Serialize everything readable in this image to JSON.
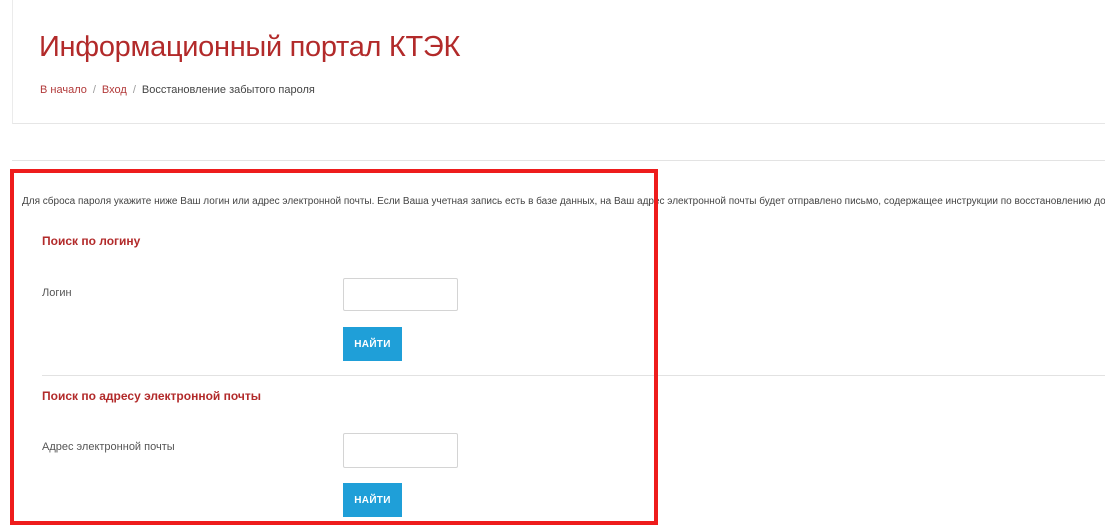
{
  "header": {
    "title": "Информационный портал КТЭК",
    "breadcrumb": {
      "home": "В начало",
      "separator": "/",
      "login": "Вход",
      "current": "Восстановление забытого пароля"
    }
  },
  "main": {
    "instructions": "Для сброса пароля укажите ниже Ваш логин или адрес электронной почты. Если Ваша учетная запись есть в базе данных, на Ваш адрес электронной почты будет отправлено письмо, содержащее инструкции по восстановлению доступа",
    "login_section": {
      "title": "Поиск по логину",
      "field_label": "Логин",
      "value": "",
      "button_label": "НАЙТИ"
    },
    "email_section": {
      "title": "Поиск по адресу электронной почты",
      "field_label": "Адрес электронной почты",
      "value": "",
      "button_label": "НАЙТИ"
    }
  },
  "colors": {
    "title_red": "#b22a2a",
    "button_blue": "#1f9fd8",
    "highlight_red": "#ee1c1c"
  }
}
